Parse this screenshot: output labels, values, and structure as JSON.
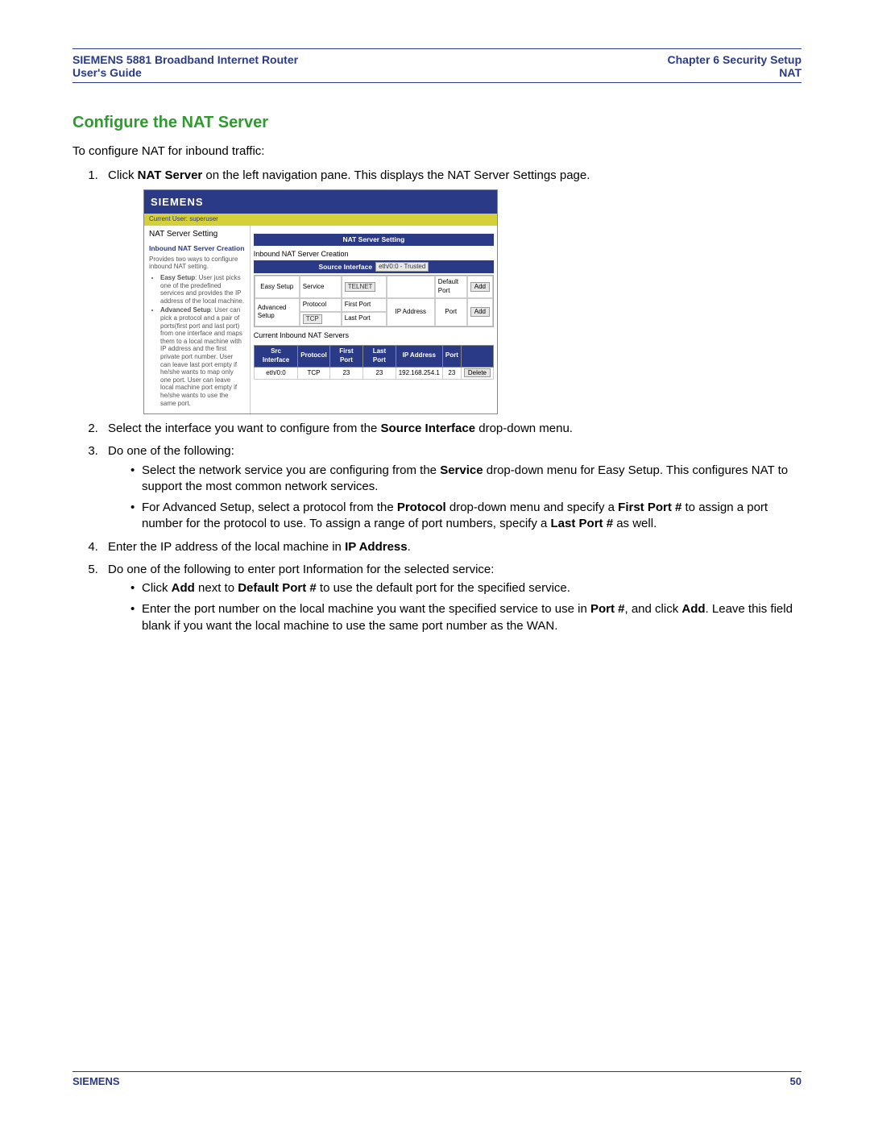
{
  "header": {
    "left_line1": "SIEMENS 5881 Broadband Internet Router",
    "left_line2": "User's Guide",
    "right_line1": "Chapter 6  Security Setup",
    "right_line2": "NAT"
  },
  "section_title": "Configure the NAT Server",
  "intro": "To configure NAT for inbound traffic:",
  "step1_pre": "Click ",
  "step1_bold": "NAT Server",
  "step1_post": " on the left navigation pane. This displays the NAT Server Settings page.",
  "step2_pre": "Select the interface you want to configure from the ",
  "step2_bold": "Source Interface",
  "step2_post": " drop-down menu.",
  "step3": "Do one of the following:",
  "step3_b1_pre": "Select the network service you are configuring from the ",
  "step3_b1_bold": "Service",
  "step3_b1_post": " drop-down menu for Easy Setup. This configures NAT to support the most common network services.",
  "step3_b2_pre": "For Advanced Setup, select a protocol from the ",
  "step3_b2_bold1": "Protocol",
  "step3_b2_mid": " drop-down menu and specify a ",
  "step3_b2_bold2": "First Port #",
  "step3_b2_mid2": " to assign a port number for the protocol to use. To assign a range of port numbers, specify a ",
  "step3_b2_bold3": "Last Port #",
  "step3_b2_post": " as well.",
  "step4_pre": "Enter the IP address of the local machine in ",
  "step4_bold": "IP Address",
  "step4_post": ".",
  "step5": "Do one of the following to enter port Information for the selected service:",
  "step5_b1_pre": "Click ",
  "step5_b1_bold1": "Add",
  "step5_b1_mid": " next to ",
  "step5_b1_bold2": "Default Port #",
  "step5_b1_post": " to use the default port for the specified service.",
  "step5_b2_pre": "Enter the port number on the local machine you want the specified service to use in ",
  "step5_b2_bold1": "Port #",
  "step5_b2_mid": ", and click ",
  "step5_b2_bold2": "Add",
  "step5_b2_post": ". Leave this field blank if you want the local machine to use the same port number as the WAN.",
  "footer": {
    "brand": "SIEMENS",
    "page": "50"
  },
  "shot": {
    "logo": "SIEMENS",
    "current_user": "Current User: superuser",
    "left_title": "NAT Server Setting",
    "left_sub": "Inbound NAT Server Creation",
    "left_desc": "Provides two ways to configure inbound NAT setting.",
    "left_easy_b": "Easy Setup",
    "left_easy": ": User just picks one of the predefined services and provides the IP address of the local machine.",
    "left_adv_b": "Advanced Setup",
    "left_adv": ": User can pick a protocol and a pair of ports(first port and last port) from one interface and maps them to a local machine with IP address and the first private port number. User can leave last port empty if he/she wants to map only one port. User can leave local machine port empty if he/she wants to use the same port.",
    "panel_title": "NAT Server Setting",
    "creation": "Inbound NAT Server Creation",
    "src_iface_label": "Source Interface",
    "src_iface_value": "eth/0:0 - Trusted",
    "easy_label": "Easy Setup",
    "service_label": "Service",
    "service_value": "TELNET",
    "default_port": "Default Port",
    "add": "Add",
    "adv_label": "Advanced Setup",
    "protocol_label": "Protocol",
    "protocol_value": "TCP",
    "first_port": "First Port",
    "last_port": "Last Port",
    "ip_address": "IP Address",
    "port_label": "Port",
    "current_servers": "Current Inbound NAT Servers",
    "th_src": "Src Interface",
    "th_proto": "Protocol",
    "th_first": "First Port",
    "th_last": "Last Port",
    "th_ip": "IP Address",
    "th_port": "Port",
    "row": {
      "src": "eth/0:0",
      "proto": "TCP",
      "first": "23",
      "last": "23",
      "ip": "192.168.254.1",
      "port": "23",
      "action": "Delete"
    }
  }
}
